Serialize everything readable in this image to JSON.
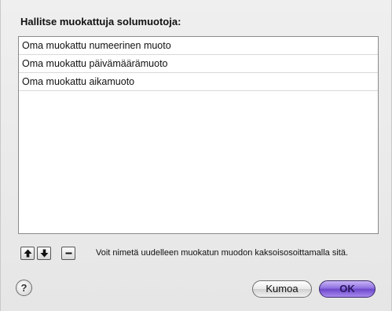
{
  "dialog": {
    "heading": "Hallitse muokattuja solumuotoja:"
  },
  "formats": {
    "items": [
      {
        "label": "Oma muokattu numeerinen muoto"
      },
      {
        "label": "Oma muokattu päivämäärämuoto"
      },
      {
        "label": "Oma muokattu aikamuoto"
      }
    ]
  },
  "controls": {
    "move_up_icon": "arrow-up",
    "move_down_icon": "arrow-down",
    "remove_icon": "minus",
    "hint": "Voit nimetä uudelleen muokatun muodon kaksoisosoittamalla sitä."
  },
  "footer": {
    "help_label": "?",
    "cancel_label": "Kumoa",
    "ok_label": "OK"
  }
}
